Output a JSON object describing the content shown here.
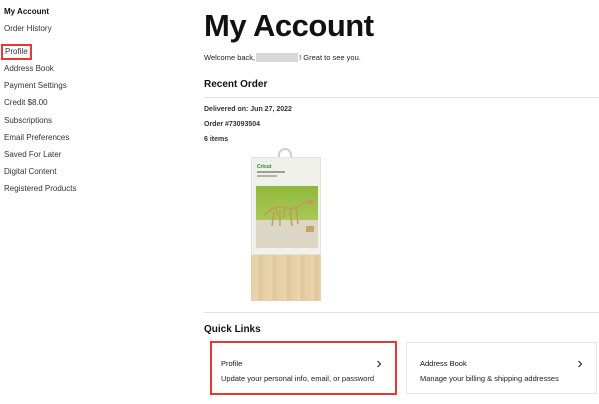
{
  "sidebar": {
    "items": [
      {
        "label": "My Account"
      },
      {
        "label": "Order History"
      },
      {
        "label": "Profile"
      },
      {
        "label": "Address Book"
      },
      {
        "label": "Payment Settings"
      },
      {
        "label": "Credit $8.00"
      },
      {
        "label": "Subscriptions"
      },
      {
        "label": "Email Preferences"
      },
      {
        "label": "Saved For Later"
      },
      {
        "label": "Digital Content"
      },
      {
        "label": "Registered Products"
      }
    ]
  },
  "main": {
    "title": "My Account",
    "welcome_prefix": "Welcome back,",
    "welcome_suffix": "! Great to see you.",
    "recent_order": {
      "heading": "Recent Order",
      "delivered": "Delivered on: Jun 27, 2022",
      "order_number": "Order #73093504",
      "item_count": "6 items",
      "product_brand": "Cricut"
    },
    "quick_links": {
      "heading": "Quick Links",
      "cards": [
        {
          "title": "Profile",
          "description": "Update your personal info, email, or password"
        },
        {
          "title": "Address Book",
          "description": "Manage your billing & shipping addresses"
        }
      ]
    }
  },
  "colors": {
    "highlight": "#e53935",
    "divider": "#e3e3e3"
  }
}
